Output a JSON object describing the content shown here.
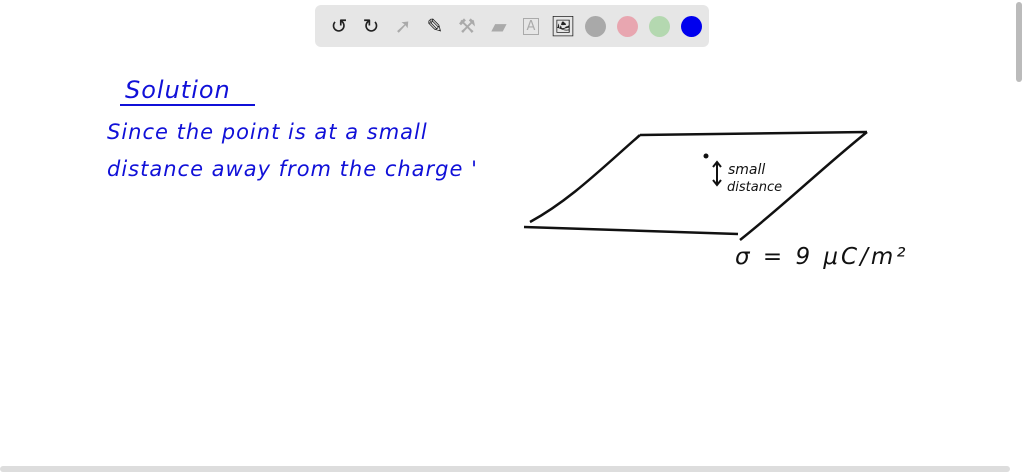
{
  "toolbar": {
    "tools": [
      "undo-icon",
      "redo-icon",
      "pointer-icon",
      "pen-icon",
      "tools-icon",
      "eraser-icon",
      "text-icon",
      "image-icon"
    ],
    "colors": [
      "#a9a9a9",
      "#e8a6b0",
      "#b4d8b0",
      "#0000ee"
    ]
  },
  "board": {
    "heading": "Solution",
    "line1": "Since the point  is at a small",
    "line2": "distance away from the charge '",
    "label_small": "small",
    "label_distance": "distance",
    "sigma": "σ = 9 μC/m²"
  }
}
